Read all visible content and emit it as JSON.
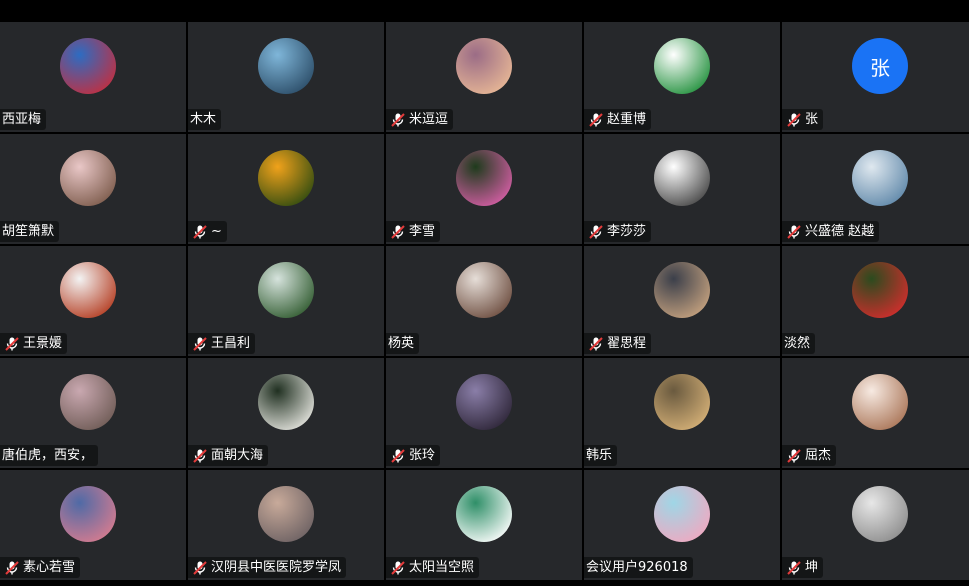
{
  "participants": [
    {
      "name": "西亚梅",
      "muted": false,
      "avatar": "photo-red-blossoms",
      "bg": [
        "#2d6cc2",
        "#c42e3e"
      ]
    },
    {
      "name": "木木",
      "muted": false,
      "avatar": "photo-person-sea-sunset",
      "bg": [
        "#7fb6d9",
        "#2a4b66"
      ]
    },
    {
      "name": "米逗逗",
      "muted": true,
      "avatar": "photo-cartoon-girl",
      "bg": [
        "#9b6c86",
        "#e9b996"
      ]
    },
    {
      "name": "赵重博",
      "muted": true,
      "avatar": "logo-school-emblem",
      "bg": [
        "#ffffff",
        "#1f8f3a"
      ]
    },
    {
      "name": "张",
      "muted": true,
      "avatar": "text",
      "letter": "张"
    },
    {
      "name": "胡笙箫默",
      "muted": false,
      "avatar": "photo-baby-hat",
      "bg": [
        "#e9c7c7",
        "#7b5a4a"
      ]
    },
    {
      "name": "~",
      "muted": true,
      "avatar": "photo-sunflower-field",
      "bg": [
        "#f0a21b",
        "#2d4a10"
      ]
    },
    {
      "name": "李雪",
      "muted": true,
      "avatar": "photo-pink-lotus",
      "bg": [
        "#1e3b1c",
        "#d85fa8"
      ]
    },
    {
      "name": "李莎莎",
      "muted": true,
      "avatar": "badge-li-character",
      "bg": [
        "#ffffff",
        "#444444"
      ]
    },
    {
      "name": "兴盛德  赵越",
      "muted": true,
      "avatar": "photo-clouds-sky",
      "bg": [
        "#dfe8ef",
        "#5d86a8"
      ]
    },
    {
      "name": "王景媛",
      "muted": true,
      "avatar": "photo-cartoon-hair",
      "bg": [
        "#f3f3f3",
        "#b33a1e"
      ]
    },
    {
      "name": "王昌利",
      "muted": true,
      "avatar": "photo-pine-trees",
      "bg": [
        "#d6e3dd",
        "#2f5a2e"
      ]
    },
    {
      "name": "杨英",
      "muted": false,
      "avatar": "photo-couple",
      "bg": [
        "#e6ded8",
        "#6b4b3d"
      ]
    },
    {
      "name": "翟思程",
      "muted": true,
      "avatar": "photo-anime-scene",
      "bg": [
        "#3b3f4a",
        "#c8a480"
      ]
    },
    {
      "name": "淡然",
      "muted": false,
      "avatar": "photo-strawberries",
      "bg": [
        "#2b4b1e",
        "#d52d2d"
      ]
    },
    {
      "name": "唐伯虎，西安，",
      "muted": false,
      "avatar": "photo-peach-blossom",
      "bg": [
        "#c9a8b0",
        "#6d5a54"
      ]
    },
    {
      "name": "面朝大海",
      "muted": true,
      "avatar": "photo-daisies",
      "bg": [
        "#203021",
        "#e7e7e1"
      ]
    },
    {
      "name": "张玲",
      "muted": true,
      "avatar": "photo-anime-girl",
      "bg": [
        "#8a7ea8",
        "#2c2436"
      ]
    },
    {
      "name": "韩乐",
      "muted": false,
      "avatar": "photo-cat-window",
      "bg": [
        "#6a5a3f",
        "#d7b278"
      ]
    },
    {
      "name": "屈杰",
      "muted": true,
      "avatar": "photo-cartoon-doll",
      "bg": [
        "#f7eae2",
        "#a87355"
      ]
    },
    {
      "name": "素心若雪",
      "muted": true,
      "avatar": "photo-dusk-sky",
      "bg": [
        "#4f6aa6",
        "#d97c8f"
      ]
    },
    {
      "name": "汉阴县中医医院罗学凤",
      "muted": true,
      "avatar": "photo-sunset-haze",
      "bg": [
        "#c8aa9a",
        "#6b6062"
      ]
    },
    {
      "name": "太阳当空照",
      "muted": true,
      "avatar": "photo-cartoon-teacher",
      "bg": [
        "#2f8f68",
        "#ffffff"
      ]
    },
    {
      "name": "会议用户926018",
      "muted": false,
      "avatar": "photo-pink-cartoon",
      "bg": [
        "#9fd6e6",
        "#f1a8c0"
      ]
    },
    {
      "name": "坤",
      "muted": true,
      "avatar": "photo-sketch-portrait",
      "bg": [
        "#e7e7e7",
        "#8b8b8b"
      ]
    }
  ]
}
